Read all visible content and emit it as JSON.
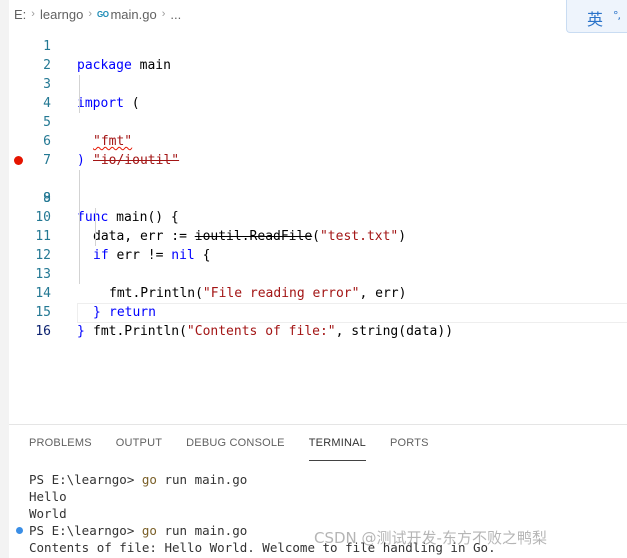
{
  "breadcrumb": {
    "drive": "E:",
    "folder": "learngo",
    "go_badge": "GO",
    "file": "main.go",
    "more": "..."
  },
  "ime": {
    "mode": "英",
    "indicator": "°,"
  },
  "editor": {
    "breakpoint_color": "#e51400",
    "lines": [
      {
        "n": "1"
      },
      {
        "n": "2"
      },
      {
        "n": "3"
      },
      {
        "n": "4"
      },
      {
        "n": "5"
      },
      {
        "n": "6"
      },
      {
        "n": "7"
      },
      {
        "n": "8"
      },
      {
        "n": "9"
      },
      {
        "n": "10"
      },
      {
        "n": "11"
      },
      {
        "n": "12"
      },
      {
        "n": "13"
      },
      {
        "n": "14"
      },
      {
        "n": "15"
      },
      {
        "n": "16"
      }
    ],
    "code": {
      "l1_kw": "package",
      "l1_rest": " main",
      "l3_kw": "import",
      "l3_rest": " (",
      "l4_str": "\"fmt\"",
      "l5_str": "\"io/ioutil\"",
      "l6": ")",
      "l8_kw": "func",
      "l8_rest": " main() {",
      "l9_a": "data, err := ",
      "l9_b": "ioutil.ReadFile",
      "l9_c": "(",
      "l9_str": "\"test.txt\"",
      "l9_d": ")",
      "l10_kw": "if",
      "l10_a": " err != ",
      "l10_kw2": "nil",
      "l10_b": " {",
      "l11_a": "fmt.Println(",
      "l11_str": "\"File reading error\"",
      "l11_b": ", err)",
      "l12_kw": "return",
      "l13": "}",
      "l14_a": "fmt.Println(",
      "l14_str": "\"Contents of file:\"",
      "l14_b": ", string(data))",
      "l15": "}"
    }
  },
  "panel": {
    "tabs": [
      "PROBLEMS",
      "OUTPUT",
      "DEBUG CONSOLE",
      "TERMINAL",
      "PORTS"
    ],
    "active_tab": "TERMINAL"
  },
  "terminal": {
    "lines": [
      {
        "prompt": "PS E:\\learngo> ",
        "cmd": "go",
        "args": " run main.go"
      },
      {
        "text": "Hello"
      },
      {
        "text": "World"
      },
      {
        "prompt": "PS E:\\learngo> ",
        "cmd": "go",
        "args": " run main.go"
      },
      {
        "text": "Contents of file: Hello World. Welcome to file handling in Go."
      }
    ]
  },
  "watermark": "CSDN @测试开发-东方不败之鸭梨"
}
